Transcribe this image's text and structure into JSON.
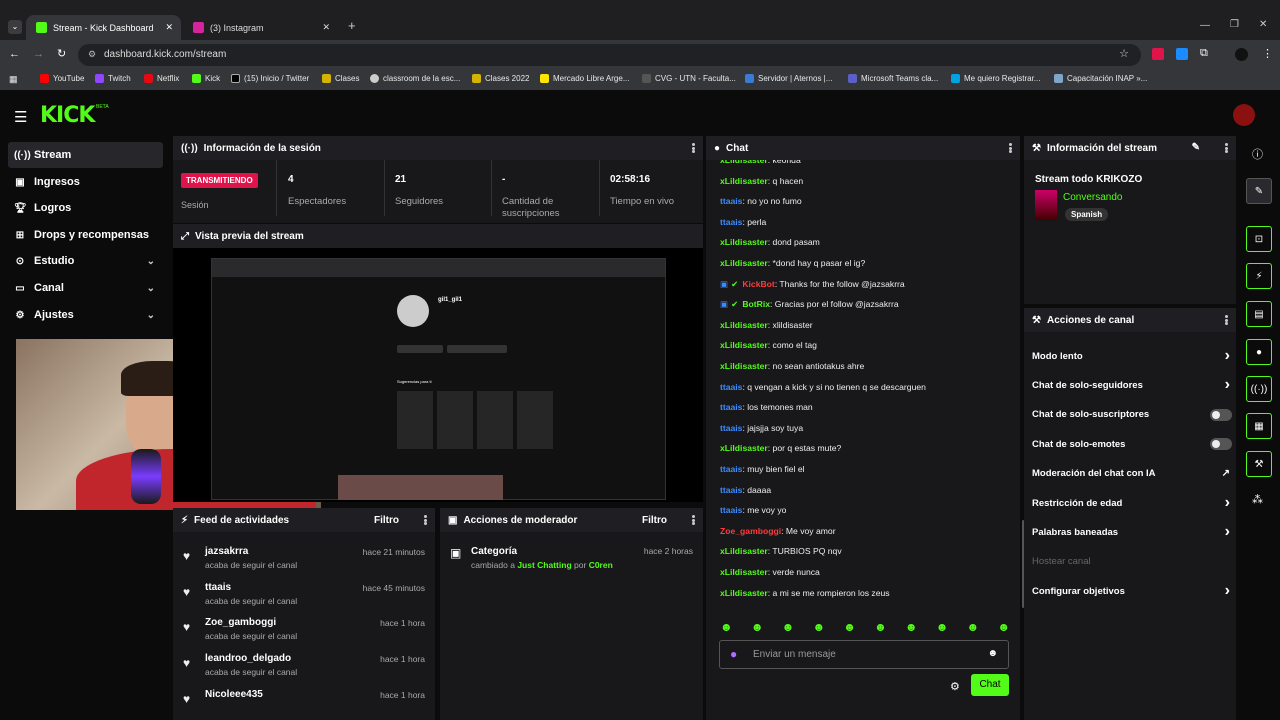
{
  "browser": {
    "tabs": [
      {
        "title": "Stream - Kick Dashboard"
      },
      {
        "title": "(3) Instagram"
      }
    ],
    "url": "dashboard.kick.com/stream",
    "bookmarks": [
      "YouTube",
      "Twitch",
      "Netflix",
      "Kick",
      "(15) Inicio / Twitter",
      "Clases",
      "classroom de la esc...",
      "Clases 2022",
      "Mercado Libre Arge...",
      "CVG - UTN - Faculta...",
      "Servidor | Aternos |...",
      "Microsoft Teams cla...",
      "Me quiero Registrar...",
      "Capacitación INAP »..."
    ]
  },
  "logo": "KICK",
  "logo_badge": "BETA",
  "sidebar": {
    "items": [
      {
        "label": "Stream",
        "icon": "stream-icon"
      },
      {
        "label": "Ingresos",
        "icon": "revenue-icon"
      },
      {
        "label": "Logros",
        "icon": "trophy-icon"
      },
      {
        "label": "Drops y recompensas",
        "icon": "gift-icon"
      },
      {
        "label": "Estudio",
        "icon": "studio-icon"
      },
      {
        "label": "Canal",
        "icon": "channel-icon"
      },
      {
        "label": "Ajustes",
        "icon": "gear-icon"
      }
    ]
  },
  "session": {
    "title": "Información de la sesión",
    "status": "TRANSMITIENDO",
    "status_label": "Sesión",
    "stats": [
      {
        "value": "4",
        "label": "Espectadores"
      },
      {
        "value": "21",
        "label": "Seguidores"
      },
      {
        "value": "-",
        "label": "Cantidad de suscripciones"
      },
      {
        "value": "02:58:16",
        "label": "Tiempo en vivo"
      }
    ]
  },
  "preview": {
    "title": "Vista previa del stream",
    "ig_user": "gil1_gil1",
    "ig_suggest": "Sugerencias para ti"
  },
  "feed": {
    "title": "Feed de actividades",
    "filter": "Filtro",
    "items": [
      {
        "user": "jazsakrra",
        "sub": "acaba de seguir el canal",
        "time": "hace 21 minutos"
      },
      {
        "user": "ttaais",
        "sub": "acaba de seguir el canal",
        "time": "hace 45 minutos"
      },
      {
        "user": "Zoe_gamboggi",
        "sub": "acaba de seguir el canal",
        "time": "hace 1 hora"
      },
      {
        "user": "leandroo_delgado",
        "sub": "acaba de seguir el canal",
        "time": "hace 1 hora"
      },
      {
        "user": "Nicoleee435",
        "sub": "",
        "time": "hace 1 hora"
      }
    ]
  },
  "mod": {
    "title": "Acciones de moderador",
    "filter": "Filtro",
    "item": {
      "title": "Categoría",
      "pre": "cambiado a",
      "cat": "Just Chatting",
      "by": "por",
      "user": "C0ren",
      "time": "hace 2 horas"
    }
  },
  "chat": {
    "title": "Chat",
    "placeholder": "Enviar un mensaje",
    "send": "Chat",
    "lines": [
      {
        "u": "xLildisaster",
        "c": "g",
        "m": ": keonda"
      },
      {
        "u": "xLildisaster",
        "c": "g",
        "m": ": q hacen"
      },
      {
        "u": "ttaais",
        "c": "b",
        "m": ": no yo no fumo"
      },
      {
        "u": "ttaais",
        "c": "b",
        "m": ": perla"
      },
      {
        "u": "xLildisaster",
        "c": "g",
        "m": ": dond pasam"
      },
      {
        "u": "xLildisaster",
        "c": "g",
        "m": ": *dond hay q pasar el ig?"
      },
      {
        "u": "KickBot",
        "c": "r",
        "m": ": Thanks for the follow @jazsakrra",
        "badge": true
      },
      {
        "u": "BotRix",
        "c": "g",
        "m": ": Gracias por el follow @jazsakrra",
        "badge": true
      },
      {
        "u": "xLildisaster",
        "c": "g",
        "m": ": xlildisaster"
      },
      {
        "u": "xLildisaster",
        "c": "g",
        "m": ": como el tag"
      },
      {
        "u": "xLildisaster",
        "c": "g",
        "m": ": no sean antiotakus ahre"
      },
      {
        "u": "ttaais",
        "c": "b",
        "m": ": q vengan a kick y si no tienen q se descarguen"
      },
      {
        "u": "ttaais",
        "c": "b",
        "m": ": los temones man"
      },
      {
        "u": "ttaais",
        "c": "b",
        "m": ": jajsjja soy tuya"
      },
      {
        "u": "xLildisaster",
        "c": "g",
        "m": ": por q estas mute?"
      },
      {
        "u": "ttaais",
        "c": "b",
        "m": ": muy bien fiel el"
      },
      {
        "u": "ttaais",
        "c": "b",
        "m": ": daaaa"
      },
      {
        "u": "ttaais",
        "c": "b",
        "m": ": me voy yo"
      },
      {
        "u": "Zoe_gamboggi",
        "c": "r",
        "m": ": Me voy amor"
      },
      {
        "u": "xLildisaster",
        "c": "g",
        "m": ": TURBIOS PQ nqv"
      },
      {
        "u": "xLildisaster",
        "c": "g",
        "m": ": verde nunca"
      },
      {
        "u": "xLildisaster",
        "c": "g",
        "m": ": a mi se me rompieron los zeus"
      }
    ]
  },
  "streaminfo": {
    "title": "Información del stream",
    "stream_title": "Stream todo KRIKOZO",
    "category": "Conversando",
    "lang": "Spanish"
  },
  "actions": {
    "title": "Acciones de canal",
    "items": [
      {
        "label": "Modo lento",
        "ctl": "chev"
      },
      {
        "label": "Chat de solo-seguidores",
        "ctl": "chev"
      },
      {
        "label": "Chat de solo-suscriptores",
        "ctl": "toggle"
      },
      {
        "label": "Chat de solo-emotes",
        "ctl": "toggle"
      },
      {
        "label": "Moderación del chat con IA",
        "ctl": "ext"
      },
      {
        "label": "Restricción de edad",
        "ctl": "chev"
      },
      {
        "label": "Palabras baneadas",
        "ctl": "chev"
      },
      {
        "label": "Hostear canal",
        "ctl": "none"
      },
      {
        "label": "Configurar objetivos",
        "ctl": "chev"
      }
    ]
  },
  "colors": {
    "accent": "#53fc18",
    "live": "#e0134a"
  }
}
